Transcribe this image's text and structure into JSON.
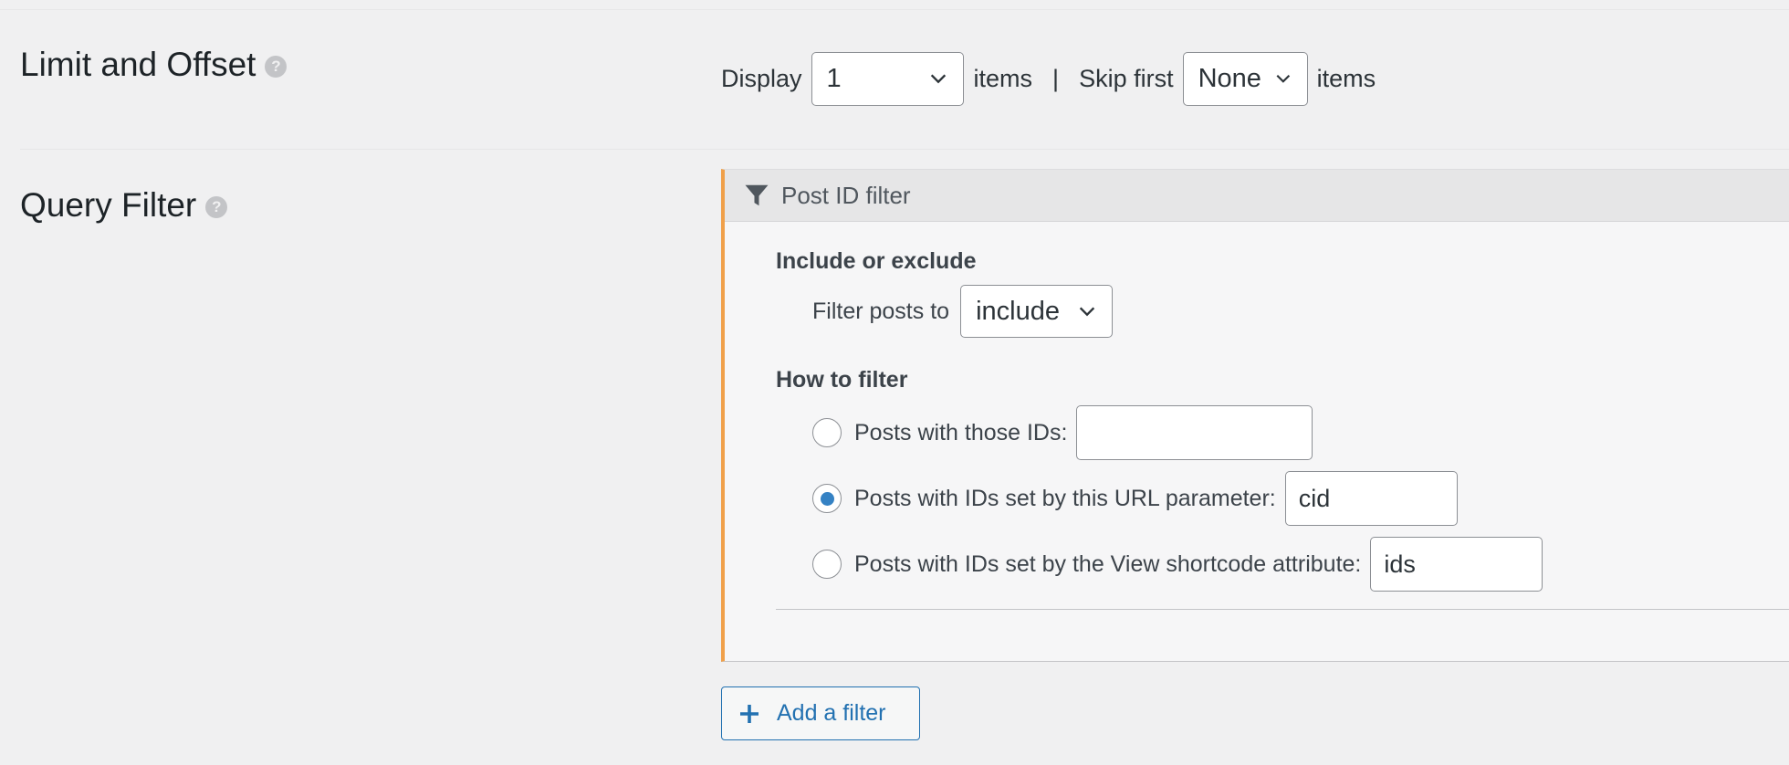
{
  "limit_offset": {
    "title": "Limit and Offset",
    "help_glyph": "?",
    "display_label": "Display",
    "display_value": "1",
    "items_label_1": "items",
    "separator": "|",
    "skip_label": "Skip first",
    "skip_value": "None",
    "items_label_2": "items"
  },
  "query_filter": {
    "title": "Query Filter",
    "help_glyph": "?",
    "panel": {
      "header_title": "Post ID filter",
      "header_icon": "funnel-icon",
      "include_heading": "Include or exclude",
      "filter_posts_label": "Filter posts to",
      "filter_posts_value": "include",
      "how_heading": "How to filter",
      "options": [
        {
          "label": "Posts with those IDs:",
          "value": "",
          "selected": false
        },
        {
          "label": "Posts with IDs set by this URL parameter:",
          "value": "cid",
          "selected": true
        },
        {
          "label": "Posts with IDs set by the View shortcode attribute:",
          "value": "ids",
          "selected": false
        }
      ]
    },
    "add_filter_label": "Add a filter"
  },
  "colors": {
    "accent_orange": "#f0a04a",
    "link_blue": "#2271b1",
    "radio_blue": "#3582c4",
    "background": "#f0f0f1"
  }
}
